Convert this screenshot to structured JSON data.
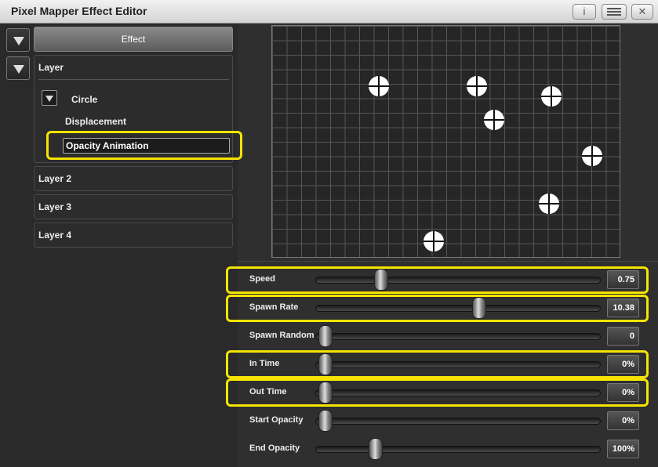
{
  "window": {
    "title": "Pixel Mapper Effect Editor"
  },
  "titlebar_buttons": {
    "info": "i"
  },
  "effect_button": "Effect",
  "tree": {
    "layer1": "Layer",
    "circle": "Circle",
    "displacement": "Displacement",
    "opacity_animation": "Opacity Animation",
    "layer2": "Layer 2",
    "layer3": "Layer 3",
    "layer4": "Layer 4"
  },
  "params": [
    {
      "label": "Speed",
      "value": "0.75",
      "level": 0.21
    },
    {
      "label": "Spawn Rate",
      "value": "10.38",
      "level": 0.58
    },
    {
      "label": "Spawn Random",
      "value": "0",
      "level": 0.0
    },
    {
      "label": "In Time",
      "value": "0%",
      "level": 0.0
    },
    {
      "label": "Out Time",
      "value": "0%",
      "level": 0.0
    },
    {
      "label": "Start Opacity",
      "value": "0%",
      "level": 0.0
    },
    {
      "label": "End Opacity",
      "value": "100%",
      "level": 0.19
    }
  ],
  "colors": {
    "highlight": "#f4e400"
  }
}
